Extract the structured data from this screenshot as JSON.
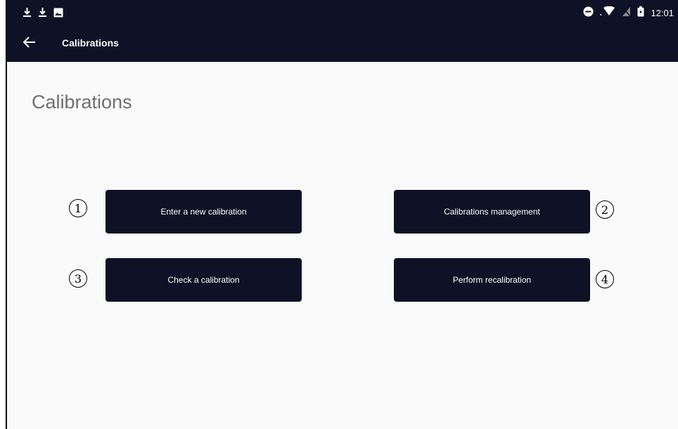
{
  "status_bar": {
    "time": "12:01",
    "left_icons": [
      "download-icon",
      "download-icon",
      "image-icon"
    ],
    "right_icons": [
      "do-not-disturb-icon",
      "wifi-icon",
      "no-sim-icon",
      "battery-icon"
    ]
  },
  "app_bar": {
    "title": "Calibrations",
    "back_icon": "arrow-back-icon"
  },
  "main": {
    "page_title": "Calibrations",
    "buttons": {
      "enter_new": "Enter a new calibration",
      "management": "Calibrations management",
      "check": "Check a calibration",
      "recalibrate": "Perform recalibration"
    },
    "markers": {
      "one": "1",
      "two": "2",
      "three": "3",
      "four": "4"
    }
  },
  "colors": {
    "primary_dark": "#0f1126",
    "background": "#fafafa",
    "title_gray": "#6e6e6e"
  }
}
